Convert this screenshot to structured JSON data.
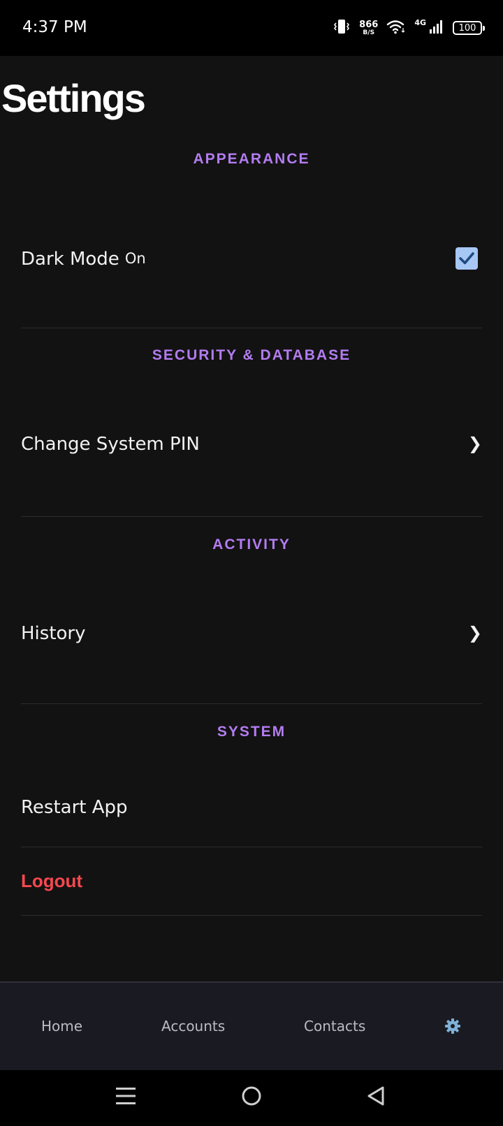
{
  "status_bar": {
    "time": "4:37 PM",
    "net_speed": "866",
    "net_speed_unit": "B/S",
    "network_type": "4G",
    "battery": "100"
  },
  "page": {
    "title": "Settings"
  },
  "sections": {
    "appearance": {
      "header": "APPEARANCE",
      "dark_mode_label": "Dark Mode",
      "dark_mode_state": "On",
      "dark_mode_checked": true
    },
    "security": {
      "header": "SECURITY & DATABASE",
      "change_pin_label": "Change System PIN",
      "chevron": "❯"
    },
    "activity": {
      "header": "ACTIVITY",
      "history_label": "History",
      "chevron": "❯"
    },
    "system": {
      "header": "SYSTEM",
      "restart_label": "Restart App",
      "logout_label": "Logout"
    }
  },
  "bottom_nav": {
    "items": [
      {
        "label": "Home"
      },
      {
        "label": "Accounts"
      },
      {
        "label": "Contacts"
      }
    ],
    "settings_icon": "gear-icon"
  },
  "system_nav": {
    "icons": [
      "menu-icon",
      "home-circle-icon",
      "back-triangle-icon"
    ]
  },
  "colors": {
    "background": "#121212",
    "accent": "#b37cf0",
    "danger": "#f5484e",
    "checkbox": "#a7c7f5",
    "nav_icon": "#7fb1d6"
  }
}
